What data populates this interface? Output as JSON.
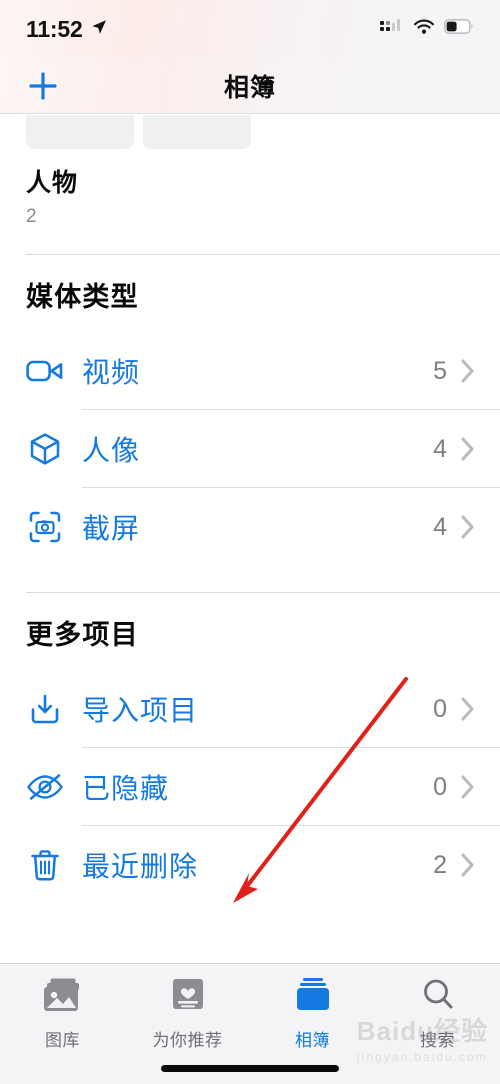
{
  "status_bar": {
    "time": "11:52",
    "location_icon": "location-arrow-icon",
    "signal_icon": "cellular-signal-icon",
    "wifi_icon": "wifi-icon",
    "battery_icon": "battery-icon"
  },
  "nav": {
    "add_label": "+",
    "title": "相簿"
  },
  "people": {
    "title": "人物",
    "count": "2"
  },
  "sections": [
    {
      "header": "媒体类型",
      "rows": [
        {
          "icon": "video-camera-icon",
          "label": "视频",
          "count": "5",
          "chevron": "chevron-right-icon"
        },
        {
          "icon": "cube-icon",
          "label": "人像",
          "count": "4",
          "chevron": "chevron-right-icon"
        },
        {
          "icon": "screenshot-icon",
          "label": "截屏",
          "count": "4",
          "chevron": "chevron-right-icon"
        }
      ]
    },
    {
      "header": "更多项目",
      "rows": [
        {
          "icon": "import-icon",
          "label": "导入项目",
          "count": "0",
          "chevron": "chevron-right-icon"
        },
        {
          "icon": "eye-slash-icon",
          "label": "已隐藏",
          "count": "0",
          "chevron": "chevron-right-icon"
        },
        {
          "icon": "trash-icon",
          "label": "最近删除",
          "count": "2",
          "chevron": "chevron-right-icon"
        }
      ]
    }
  ],
  "tab_bar": {
    "tabs": [
      {
        "icon": "photo-library-icon",
        "label": "图库",
        "active": false
      },
      {
        "icon": "for-you-card-icon",
        "label": "为你推荐",
        "active": false
      },
      {
        "icon": "albums-stack-icon",
        "label": "相簿",
        "active": true
      },
      {
        "icon": "search-magnifier-icon",
        "label": "搜索",
        "active": false
      }
    ]
  },
  "annotation": {
    "type": "red-arrow",
    "color": "#e0211a",
    "points_at": "最近删除"
  },
  "watermark": {
    "main": "Baidu经验",
    "sub": "jingyan.baidu.com"
  },
  "colors": {
    "accent": "#1479e0",
    "count_gray": "#7e7e84",
    "annotation_red": "#e0211a"
  }
}
